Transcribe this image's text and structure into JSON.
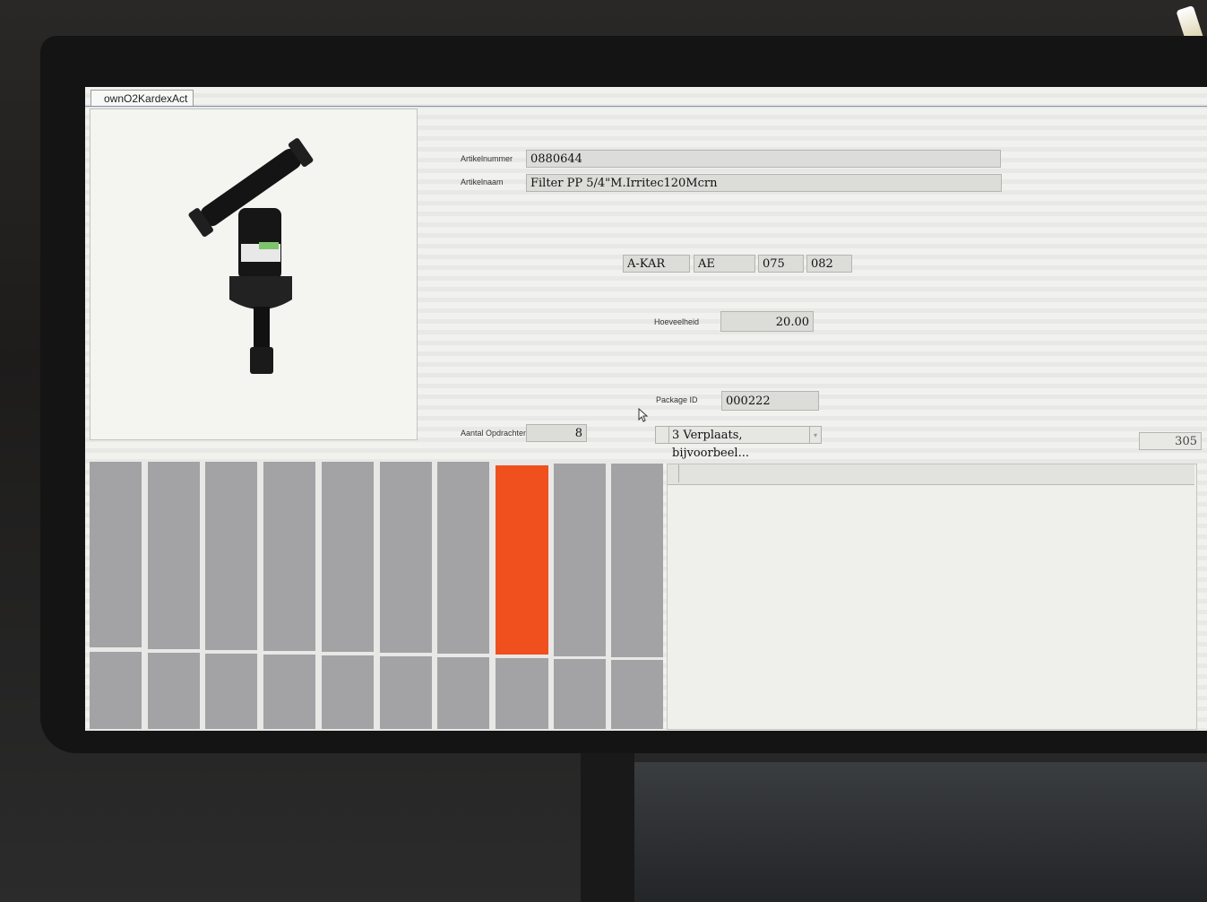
{
  "window": {
    "tab_title": "ownO2KardexAct"
  },
  "article": {
    "number_label": "Artikelnummer",
    "number_value": "0880644",
    "name_label": "Artikelnaam",
    "name_value": "Filter PP 5/4\"M.Irritec120Mcrn"
  },
  "location": {
    "codes": [
      "A-KAR",
      "AE",
      "075",
      "082"
    ]
  },
  "quantity": {
    "label": "Hoeveelheid",
    "value": "20.00"
  },
  "package": {
    "label": "Package ID",
    "value": "000222"
  },
  "orders": {
    "label": "Aantal Opdrachten",
    "value": "8"
  },
  "action_select": {
    "selected": "3 Verplaats, bijvoorbeel..."
  },
  "counter": {
    "value": "305"
  },
  "bins": {
    "active_color": "#f0501e",
    "inactive_color": "#a3a3a5",
    "active_column": 8
  },
  "icons": [
    "mouse-cursor-icon"
  ]
}
